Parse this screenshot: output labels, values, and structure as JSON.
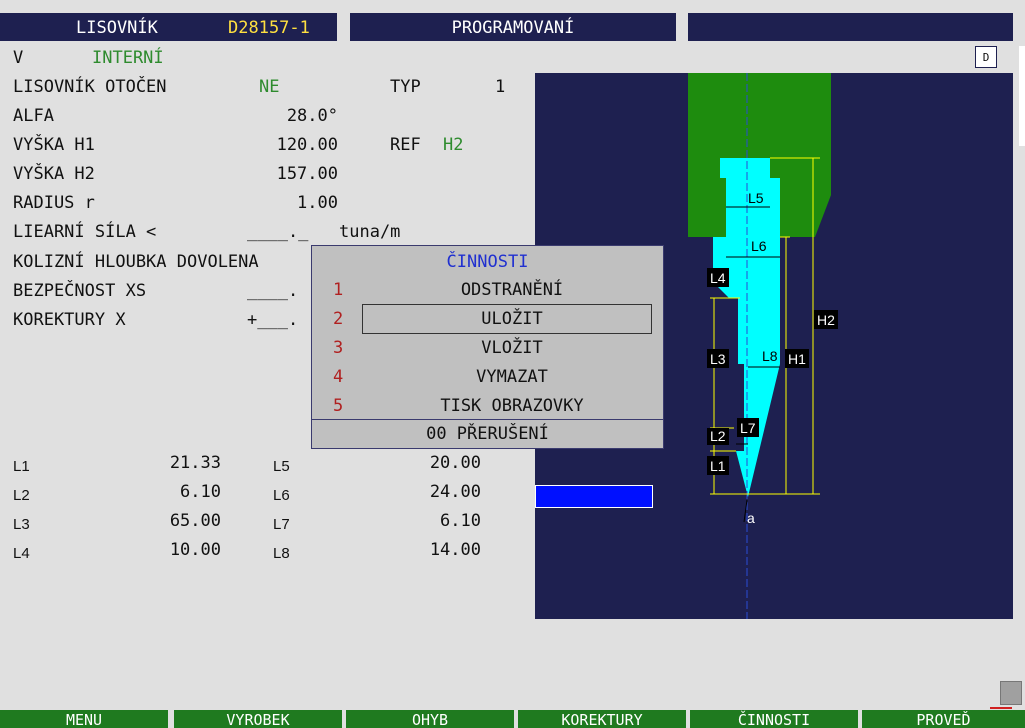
{
  "header": {
    "tool_label": "LISOVNÍK",
    "tool_id": "D28157-1",
    "mode": "PROGRAMOVANÍ",
    "right_panel": ""
  },
  "info": {
    "v_label": "V",
    "v_value": "INTERNÍ",
    "d_button": "D"
  },
  "params": {
    "rotated_label": "LISOVNÍK OTOČEN",
    "rotated_value": "NE",
    "typ_label": "TYP",
    "typ_value": "1",
    "alfa_label": "ALFA",
    "alfa_value": "28.0°",
    "h1_label": "VYŠKA H1",
    "h1_value": "120.00",
    "ref_label": "REF",
    "ref_value": "H2",
    "h2_label": "VYŠKA H2",
    "h2_value": "157.00",
    "radius_label": "RADIUS r",
    "radius_value": "1.00",
    "force_label": "LIEARNÍ SÍLA <",
    "force_value": "____._",
    "force_unit": "tuna/m",
    "coll_label": "KOLIZNÍ HLOUBKA DOVOLENA",
    "safety_label": "BEZPEČNOST XS",
    "safety_value": "____.",
    "korr_label": "KOREKTURY X",
    "korr_value": "+___."
  },
  "dims": {
    "L1": {
      "label": "L1",
      "value": "21.33"
    },
    "L2": {
      "label": "L2",
      "value": "6.10"
    },
    "L3": {
      "label": "L3",
      "value": "65.00"
    },
    "L4": {
      "label": "L4",
      "value": "10.00"
    },
    "L5": {
      "label": "L5",
      "value": "20.00"
    },
    "L6": {
      "label": "L6",
      "value": "24.00"
    },
    "L7": {
      "label": "L7",
      "value": "6.10"
    },
    "L8": {
      "label": "L8",
      "value": "14.00"
    }
  },
  "popup": {
    "title": "ČINNOSTI",
    "items": [
      {
        "num": "1",
        "label": "ODSTRANĚNÍ"
      },
      {
        "num": "2",
        "label": "ULOŽIT"
      },
      {
        "num": "3",
        "label": "VLOŽIT"
      },
      {
        "num": "4",
        "label": "VYMAZAT"
      },
      {
        "num": "5",
        "label": "TISK OBRAZOVKY"
      }
    ],
    "cancel": "00 PŘERUŠENÍ",
    "selected_index": 1
  },
  "drawing": {
    "labels": {
      "L1": "L1",
      "L2": "L2",
      "L3": "L3",
      "L4": "L4",
      "L5": "L5",
      "L6": "L6",
      "L7": "L7",
      "L8": "L8",
      "H1": "H1",
      "H2": "H2",
      "a": "a"
    },
    "colors": {
      "background": "#1e2050",
      "holder": "#1e8c0e",
      "tool": "#00ffff",
      "dimension": "#ffff00",
      "axis": "#2a4bd6"
    }
  },
  "function_keys": [
    "MENU",
    "VYROBEK",
    "OHYB",
    "KOREKTURY",
    "ČINNOSTI",
    "PROVEĎ"
  ]
}
